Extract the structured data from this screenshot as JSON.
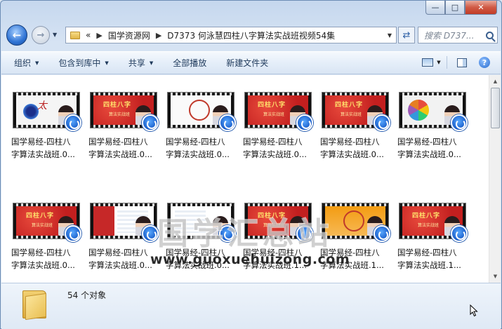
{
  "window": {
    "caption_buttons": {
      "minimize": "—",
      "maximize": "□",
      "close": "✕"
    }
  },
  "nav": {
    "back_icon": "back-arrow-icon",
    "forward_icon": "forward-arrow-icon",
    "address": {
      "overflow": "«",
      "segments": [
        "国学资源网",
        "D7373 何泳慧四柱八字算法实战班视频54集"
      ]
    },
    "search_placeholder": "搜索 D737..."
  },
  "toolbar": {
    "items": [
      {
        "label": "组织",
        "has_dropdown": true
      },
      {
        "label": "包含到库中",
        "has_dropdown": true
      },
      {
        "label": "共享",
        "has_dropdown": true
      },
      {
        "label": "全部播放",
        "has_dropdown": false
      },
      {
        "label": "新建文件夹",
        "has_dropdown": false
      }
    ]
  },
  "files": {
    "row1": [
      {
        "line1": "国学易经-四柱八",
        "line2": "字算法实战班.0...",
        "thumb": "yinyang"
      },
      {
        "line1": "国学易经-四柱八",
        "line2": "字算法实战班.0...",
        "thumb": "red-title"
      },
      {
        "line1": "国学易经-四柱八",
        "line2": "字算法实战班.0...",
        "thumb": "diagram"
      },
      {
        "line1": "国学易经-四柱八",
        "line2": "字算法实战班.0...",
        "thumb": "red-title"
      },
      {
        "line1": "国学易经-四柱八",
        "line2": "字算法实战班.0...",
        "thumb": "red-title"
      },
      {
        "line1": "国学易经-四柱八",
        "line2": "字算法实战班.0...",
        "thumb": "flower"
      }
    ],
    "row2": [
      {
        "line1": "国学易经-四柱八",
        "line2": "字算法实战班.0...",
        "thumb": "red-title"
      },
      {
        "line1": "国学易经-四柱八",
        "line2": "字算法实战班.0...",
        "thumb": "table"
      },
      {
        "line1": "国学易经-四柱八",
        "line2": "字算法实战班.0...",
        "thumb": "table"
      },
      {
        "line1": "国学易经-四柱八",
        "line2": "字算法实战班.1...",
        "thumb": "red-title"
      },
      {
        "line1": "国学易经-四柱八",
        "line2": "字算法实战班.1...",
        "thumb": "diagram"
      },
      {
        "line1": "国学易经-四柱八",
        "line2": "字算法实战班.1...",
        "thumb": "red-title"
      }
    ],
    "thumb_title": "四柱八字",
    "thumb_subtitle": "算法实战班"
  },
  "watermark": {
    "title": "国学汇总站",
    "url": "www.guoxuehuizong.com"
  },
  "status": {
    "count": "54 个对象"
  },
  "colors": {
    "accent": "#1e395b",
    "thumb_red": "#d8322e",
    "play_blue": "#1559c7"
  }
}
